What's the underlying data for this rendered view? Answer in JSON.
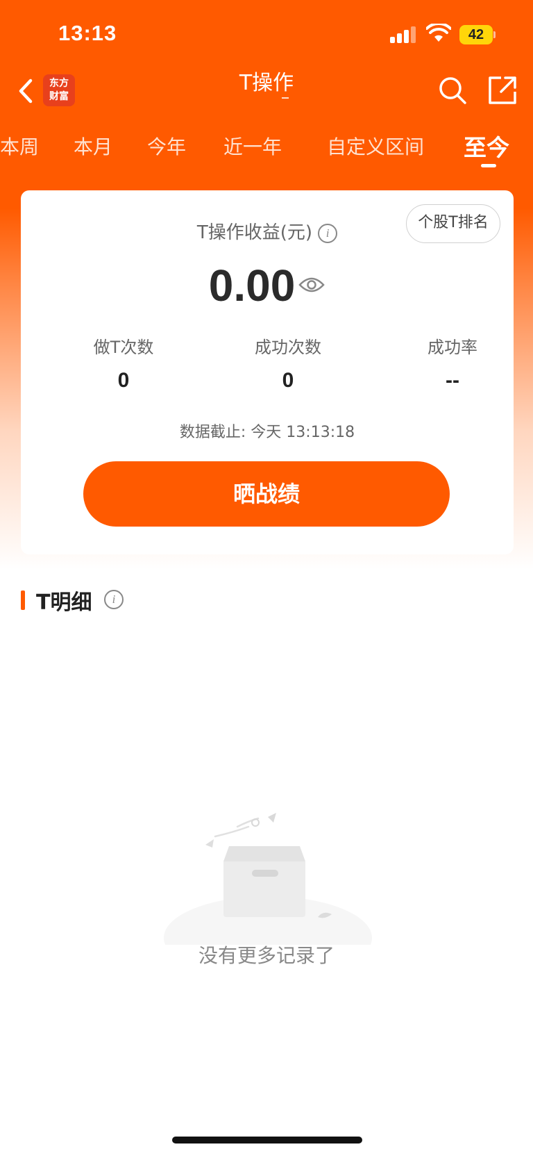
{
  "status_bar": {
    "time": "13:13",
    "battery": "42"
  },
  "nav": {
    "title": "T操作",
    "logo_line1": "东方",
    "logo_line2": "财富"
  },
  "tabs": [
    {
      "label": "本周"
    },
    {
      "label": "本月"
    },
    {
      "label": "今年"
    },
    {
      "label": "近一年"
    },
    {
      "label": "自定义区间"
    },
    {
      "label": "至今",
      "active": true
    }
  ],
  "card": {
    "rank_button": "个股T排名",
    "profit_label": "T操作收益(元)",
    "profit_value": "0.00",
    "stats": [
      {
        "label": "做T次数",
        "value": "0"
      },
      {
        "label": "成功次数",
        "value": "0"
      },
      {
        "label": "成功率",
        "value": "--"
      }
    ],
    "deadline": "数据截止: 今天 13:13:18",
    "cta": "晒战绩"
  },
  "detail": {
    "title": "T明细"
  },
  "empty": {
    "text": "没有更多记录了"
  },
  "colors": {
    "accent": "#ff5a00",
    "battery": "#ffd60a"
  }
}
